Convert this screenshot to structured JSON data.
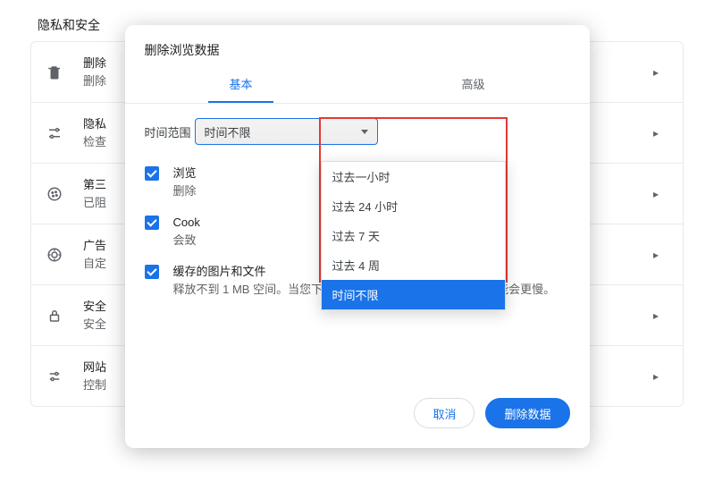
{
  "page": {
    "section_title": "隐私和安全"
  },
  "rows": {
    "r0": {
      "title": "删除",
      "sub": "删除"
    },
    "r1": {
      "title": "隐私",
      "sub": "检查"
    },
    "r2": {
      "title": "第三",
      "sub": "已阻"
    },
    "r3": {
      "title": "广告",
      "sub": "自定"
    },
    "r4": {
      "title": "安全",
      "sub": "安全"
    },
    "r5": {
      "title": "网站",
      "sub": "控制"
    }
  },
  "dialog": {
    "title": "删除浏览数据",
    "tabs": {
      "basic": "基本",
      "advanced": "高级"
    },
    "time_label": "时间范围",
    "select_value": "时间不限",
    "options": {
      "o0": "过去一小时",
      "o1": "过去 24 小时",
      "o2": "过去 7 天",
      "o3": "过去 4 周",
      "o4": "时间不限"
    },
    "checks": {
      "c0": {
        "title": "浏览",
        "sub": "删除"
      },
      "c1": {
        "title": "Cook",
        "sub": "会致"
      },
      "c2": {
        "title": "缓存的图片和文件",
        "sub": "释放不到 1 MB 空间。当您下次访问时，某些网站的加载速度可能会更慢。"
      }
    },
    "actions": {
      "cancel": "取消",
      "confirm": "删除数据"
    }
  }
}
